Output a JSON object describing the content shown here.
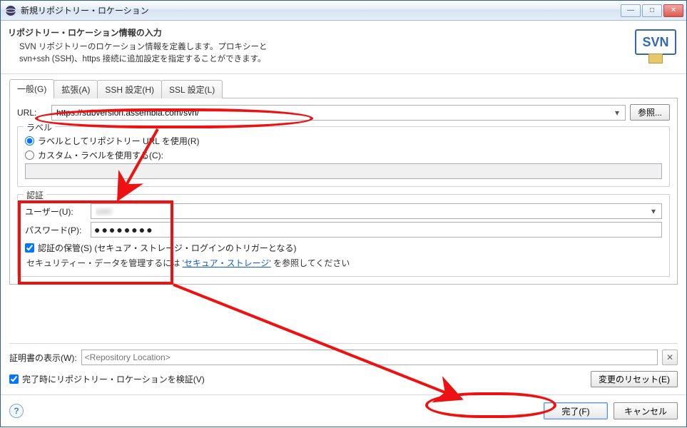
{
  "win": {
    "title": "新規リポジトリー・ロケーション"
  },
  "banner": {
    "heading": "リポジトリー・ロケーション情報の入力",
    "line1": "SVN リポジトリーのロケーション情報を定義します。プロキシーと",
    "line2": "svn+ssh (SSH)、https 接続に追加設定を指定することができます。"
  },
  "logo": "SVN",
  "tabs": {
    "general": "一般(G)",
    "advanced": "拡張(A)",
    "ssh": "SSH 設定(H)",
    "ssl": "SSL 設定(L)"
  },
  "url": {
    "label": "URL:",
    "value": "https://subversion.assembla.com/svn/"
  },
  "browse_btn": "参照...",
  "label_group": {
    "title": "ラベル",
    "use_url": "ラベルとしてリポジトリー URL を使用(R)",
    "use_custom": "カスタム・ラベルを使用する(C):"
  },
  "auth": {
    "title": "認証",
    "user_label": "ユーザー(U):",
    "user_value": "user",
    "pw_label": "パスワード(P):",
    "pw_value": "●●●●●●●●",
    "save_chk": "認証の保管(S) (セキュア・ストレージ・ログインのトリガーとなる)",
    "note_pre": "セキュリティー・データを管理するには ",
    "note_link": "'セキュア・ストレージ'",
    "note_post": " を参照してください"
  },
  "cert": {
    "label": "証明書の表示(W):",
    "placeholder": "<Repository Location>"
  },
  "verify_chk": "完了時にリポジトリー・ロケーションを検証(V)",
  "reset_btn": "変更のリセット(E)",
  "footer": {
    "finish": "完了(F)",
    "cancel": "キャンセル"
  }
}
